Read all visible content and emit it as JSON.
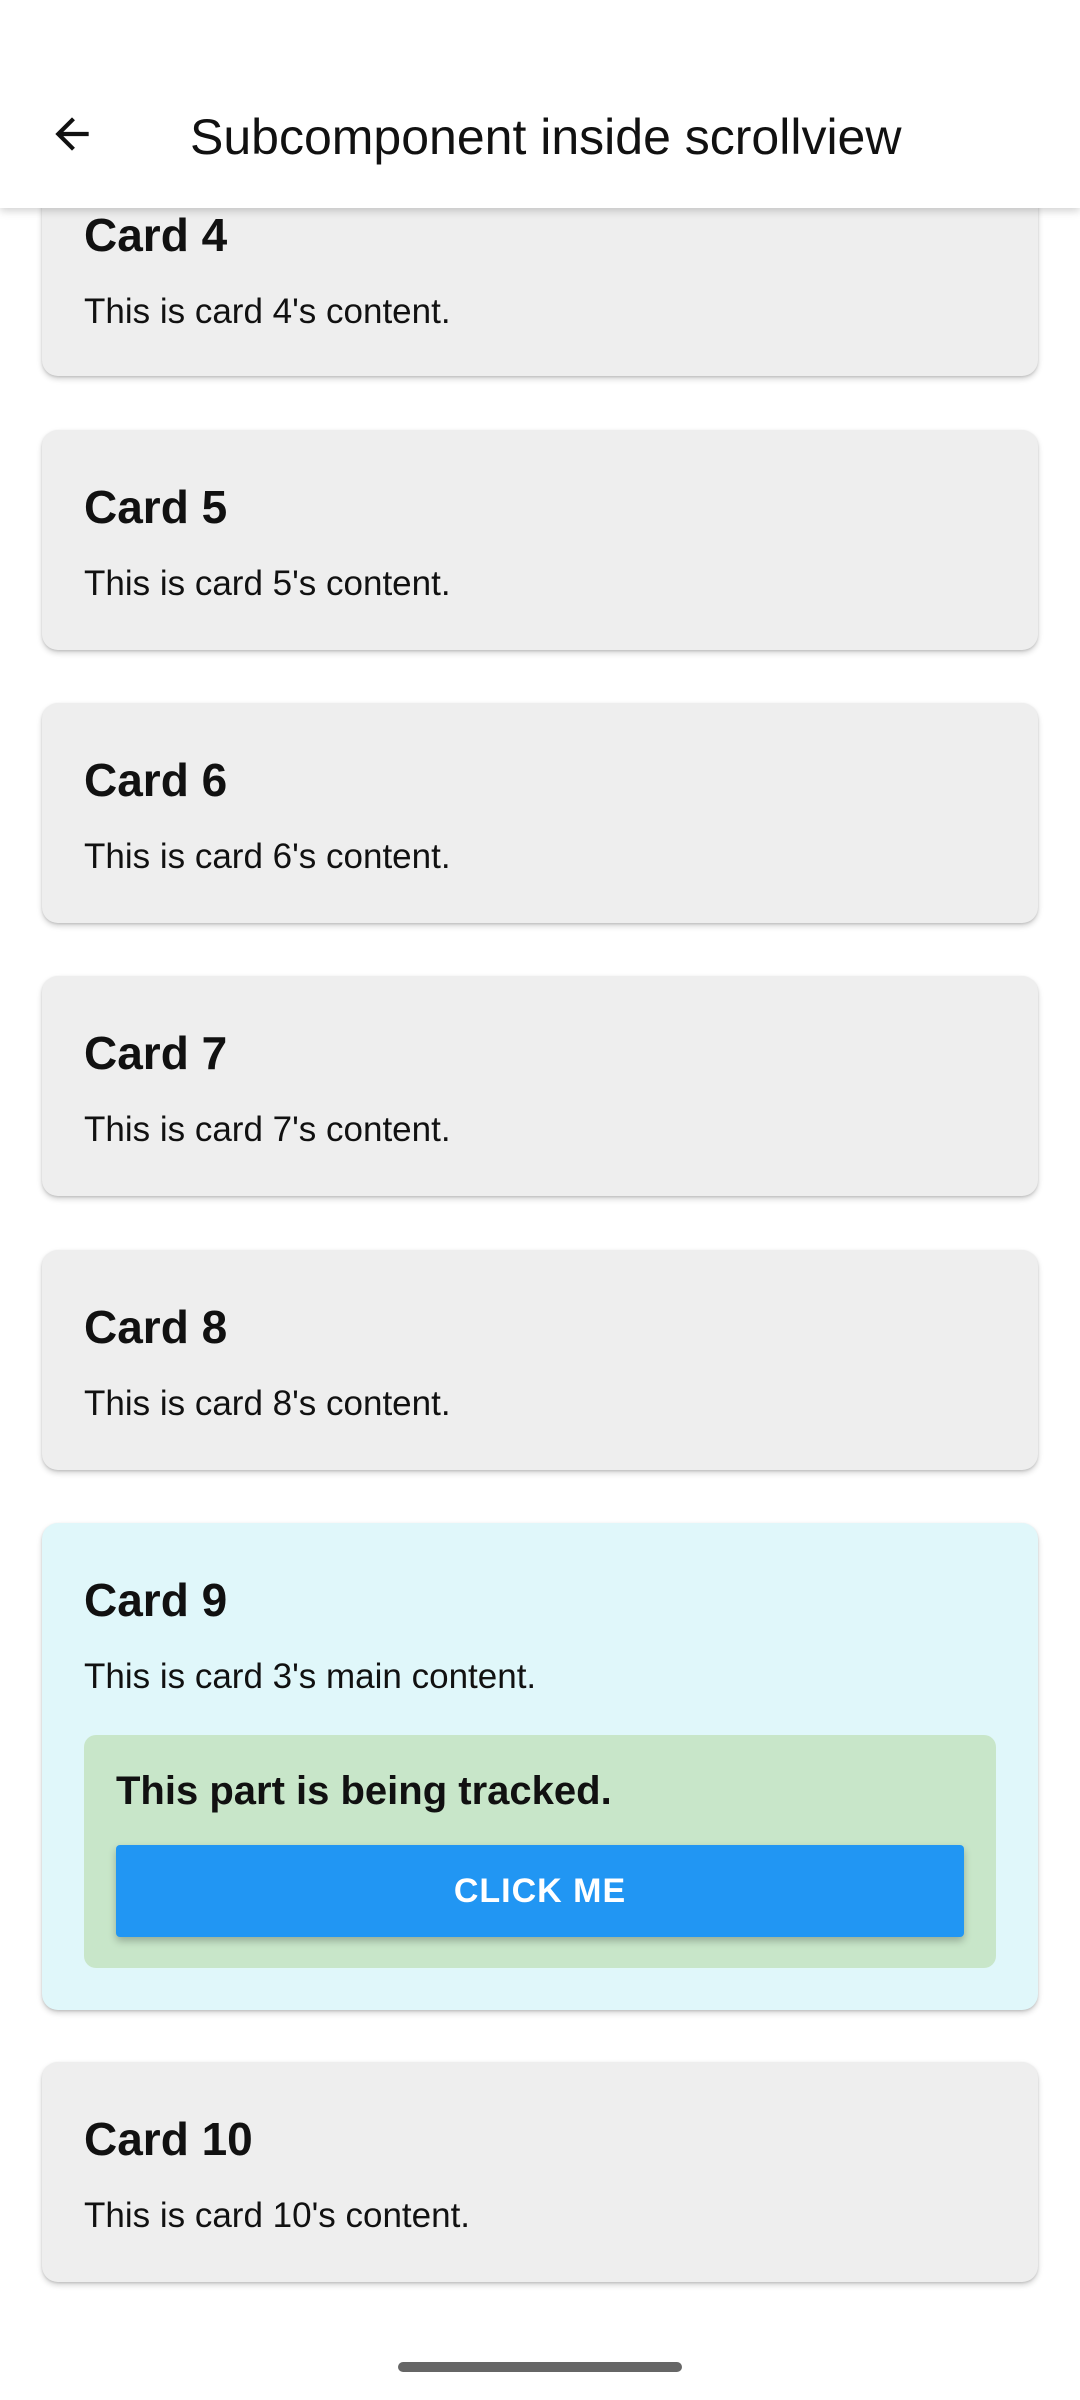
{
  "app_bar": {
    "title": "Subcomponent inside scrollview",
    "back_icon": "arrow-back-icon"
  },
  "cards": [
    {
      "title": "Card 4",
      "content": "This is card 4's content."
    },
    {
      "title": "Card 5",
      "content": "This is card 5's content."
    },
    {
      "title": "Card 6",
      "content": "This is card 6's content."
    },
    {
      "title": "Card 7",
      "content": "This is card 7's content."
    },
    {
      "title": "Card 8",
      "content": "This is card 8's content."
    },
    {
      "title": "Card 9",
      "content": "This is card 3's main content.",
      "tracked": {
        "text": "This part is being tracked.",
        "button_label": "CLICK ME"
      }
    },
    {
      "title": "Card 10",
      "content": "This is card 10's content."
    }
  ],
  "colors": {
    "card_background": "#eeeeee",
    "highlight_card_background": "#e0f7fa",
    "tracked_background": "#c8e6c9",
    "button_background": "#2196f3",
    "button_text": "#ffffff"
  }
}
